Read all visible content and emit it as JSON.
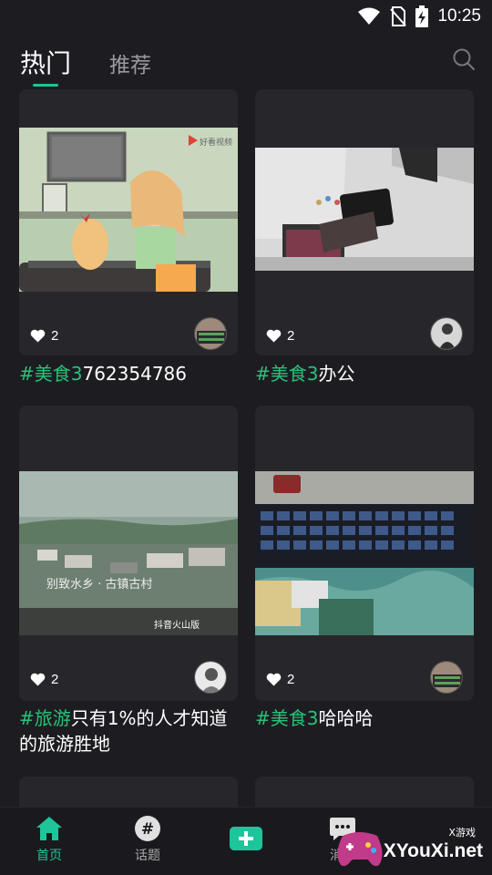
{
  "status_bar": {
    "time": "10:25"
  },
  "tabs": [
    {
      "label": "热门",
      "active": true
    },
    {
      "label": "推荐",
      "active": false
    }
  ],
  "cards": [
    {
      "tag": "#美食3",
      "title": "762354786",
      "likes": "2",
      "thumb_caption": "好看视频"
    },
    {
      "tag": "#美食3",
      "title": "办公",
      "likes": "2"
    },
    {
      "tag": "#旅游",
      "title": "只有1%的人才知道的旅游胜地",
      "likes": "2",
      "thumb_caption": "别致水乡 · 古镇古村",
      "thumb_watermark": "抖音火山版"
    },
    {
      "tag": "#美食3",
      "title": "哈哈哈",
      "likes": "2"
    }
  ],
  "bottom_nav": [
    {
      "label": "首页",
      "icon": "home-icon",
      "active": true
    },
    {
      "label": "话题",
      "icon": "hashtag-icon",
      "active": false
    },
    {
      "label": "",
      "icon": "add-icon",
      "active": false
    },
    {
      "label": "消息",
      "icon": "message-icon",
      "active": false
    }
  ],
  "watermark": {
    "site": "XYouXi.net",
    "small": "X游戏"
  },
  "colors": {
    "accent": "#1ec59a",
    "tag": "#27c27a",
    "background": "#1d1d21",
    "card": "#27272b"
  }
}
